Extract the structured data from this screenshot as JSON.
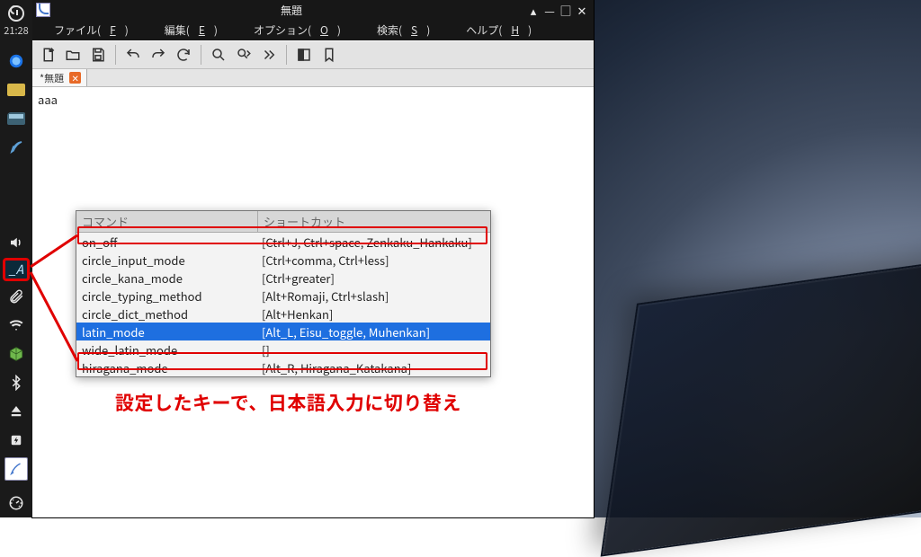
{
  "panel": {
    "time": "21:28",
    "ime_label": "_A"
  },
  "window": {
    "title": "無題",
    "menus": {
      "file": {
        "label": "ファイル(",
        "mn": "F",
        "tail": ")"
      },
      "edit": {
        "label": "編集(",
        "mn": "E",
        "tail": ")"
      },
      "option": {
        "label": "オプション(",
        "mn": "O",
        "tail": ")"
      },
      "search": {
        "label": "検索(",
        "mn": "S",
        "tail": ")"
      },
      "help": {
        "label": "ヘルプ(",
        "mn": "H",
        "tail": ")"
      }
    },
    "tab_name": "*無題",
    "editor_text": "aaa"
  },
  "shortcut_table": {
    "col1": "コマンド",
    "col2": "ショートカット",
    "rows": [
      {
        "cmd": "on_off",
        "sc": "[Ctrl+J, Ctrl+space, Zenkaku_Hankaku]"
      },
      {
        "cmd": "circle_input_mode",
        "sc": "[Ctrl+comma, Ctrl+less]"
      },
      {
        "cmd": "circle_kana_mode",
        "sc": "[Ctrl+greater]"
      },
      {
        "cmd": "circle_typing_method",
        "sc": "[Alt+Romaji, Ctrl+slash]"
      },
      {
        "cmd": "circle_dict_method",
        "sc": "[Alt+Henkan]"
      },
      {
        "cmd": "latin_mode",
        "sc": "[Alt_L, Eisu_toggle, Muhenkan]"
      },
      {
        "cmd": "wide_latin_mode",
        "sc": "[]"
      },
      {
        "cmd": "hiragana_mode",
        "sc": "[Alt_R, Hiragana_Katakana]"
      }
    ],
    "selected_index": 5
  },
  "annotation_text": "設定したキーで、日本語入力に切り替え"
}
